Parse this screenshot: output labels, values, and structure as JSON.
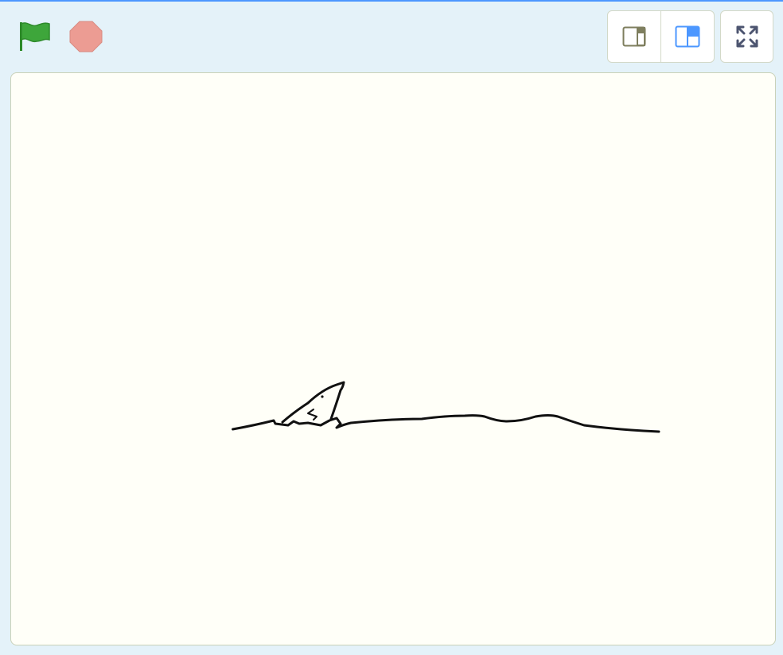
{
  "toolbar": {
    "green_flag": {
      "icon": "green-flag-icon",
      "color": "#3ea63b"
    },
    "stop": {
      "icon": "stop-sign-icon",
      "color": "#ec9c93"
    },
    "small_stage": {
      "icon": "small-stage-icon",
      "active": false
    },
    "normal_stage": {
      "icon": "normal-stage-icon",
      "active": true,
      "color": "#4c97ff"
    },
    "fullscreen": {
      "icon": "fullscreen-icon"
    }
  },
  "stage": {
    "background": "#fffff8",
    "sprite": "shark-fin-in-wave-drawing"
  }
}
